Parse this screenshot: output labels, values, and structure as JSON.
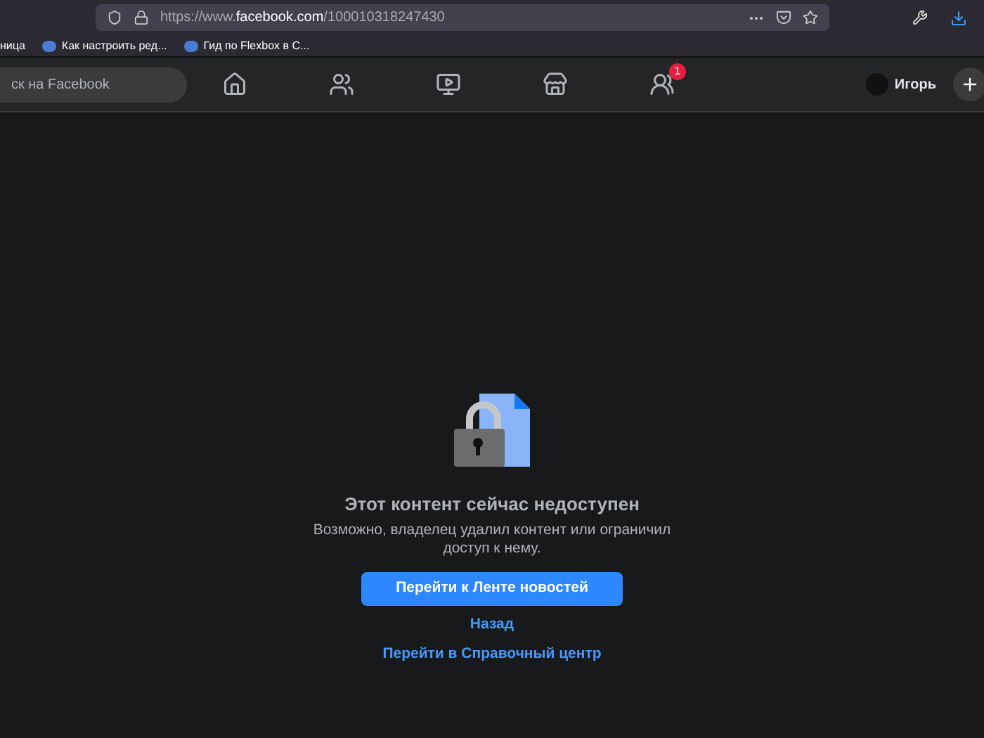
{
  "browser": {
    "url": {
      "prefix": "https://www.",
      "domain": "facebook.com",
      "path": "/100010318247430"
    }
  },
  "bookmarks": [
    {
      "label": "ница"
    },
    {
      "label": "Как настроить ред..."
    },
    {
      "label": "Гид по Flexbox в С..."
    }
  ],
  "navbar": {
    "search": {
      "placeholder": "ск на Facebook"
    },
    "nav_items": [
      {
        "kind": "home"
      },
      {
        "kind": "friends"
      },
      {
        "kind": "watch"
      },
      {
        "kind": "marketplace"
      },
      {
        "kind": "groups",
        "badge": "1"
      }
    ],
    "profile": {
      "name": "Игорь"
    }
  },
  "message": {
    "title": "Этот контент сейчас недоступен",
    "body": "Возможно, владелец удалил контент или ограничил доступ к нему.",
    "primary_button": "Перейти к Ленте новостей",
    "links": [
      "Назад",
      "Перейти в Справочный центр"
    ]
  }
}
